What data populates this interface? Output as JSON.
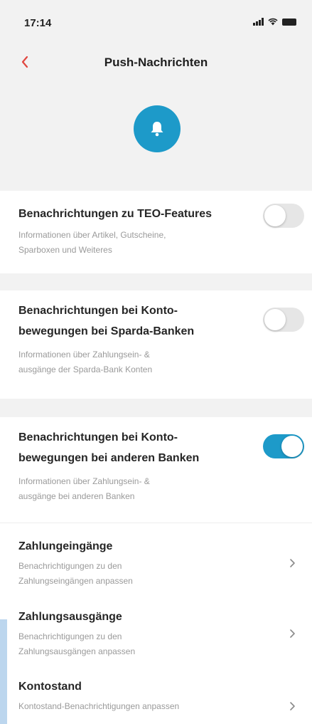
{
  "status_bar": {
    "time": "17:14"
  },
  "header": {
    "title": "Push-Nachrichten"
  },
  "sections": {
    "teo": {
      "title": "Benachrichtungen zu TEO-Features",
      "desc_line1": "Informationen über Artikel, Gutscheine,",
      "desc_line2": "Sparboxen und Weiteres",
      "toggle_on": false
    },
    "sparda": {
      "title_line1": "Benachrichtungen bei Konto-",
      "title_line2": "bewegungen bei Sparda-Banken",
      "desc_line1": "Informationen über Zahlungsein- &",
      "desc_line2": "ausgänge der Sparda-Bank Konten",
      "toggle_on": false
    },
    "other_banks": {
      "title_line1": "Benachrichtungen bei Konto-",
      "title_line2": "bewegungen bei anderen Banken",
      "desc_line1": "Informationen über Zahlungsein- &",
      "desc_line2": "ausgänge bei anderen Banken",
      "toggle_on": true
    }
  },
  "sub_items": {
    "incoming": {
      "title": "Zahlungeingänge",
      "desc_line1": "Benachrichtigungen zu den",
      "desc_line2": "Zahlungseingängen anpassen"
    },
    "outgoing": {
      "title": "Zahlungsausgänge",
      "desc_line1": "Benachrichtigungen zu den",
      "desc_line2": "Zahlungsausgängen anpassen"
    },
    "balance": {
      "title": "Kontostand",
      "desc_line1": "Kontostand-Benachrichtigungen anpassen"
    }
  },
  "colors": {
    "accent": "#1d9ac9",
    "background": "#f2f2f2",
    "card": "#ffffff"
  },
  "icons": [
    "back-chevron-icon",
    "bell-icon",
    "chevron-right-icon"
  ]
}
